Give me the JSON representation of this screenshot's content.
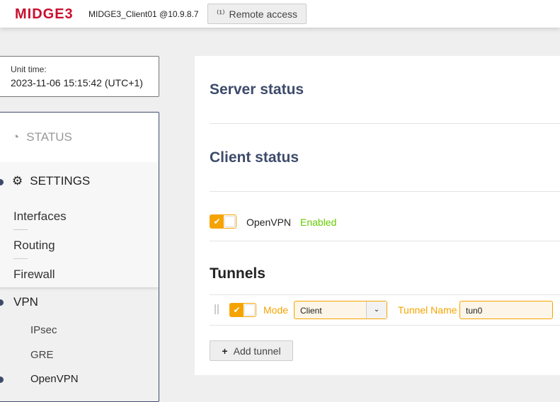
{
  "header": {
    "logo": "MIDGE3",
    "host": "MIDGE3_Client01 @10.9.8.7",
    "remote_access": "Remote access"
  },
  "unit_time": {
    "label": "Unit time:",
    "value": "2023-11-06 15:15:42 (UTC+1)"
  },
  "sidebar": {
    "status": "STATUS",
    "settings": "SETTINGS",
    "settings_items": [
      "Interfaces",
      "Routing",
      "Firewall"
    ],
    "vpn": "VPN",
    "vpn_items": [
      "IPsec",
      "GRE",
      "OpenVPN"
    ]
  },
  "main": {
    "server_status": "Server status",
    "client_status": "Client status",
    "openvpn_label": "OpenVPN",
    "openvpn_state": "Enabled",
    "tunnels_title": "Tunnels",
    "tunnel": {
      "mode_label": "Mode",
      "mode_value": "Client",
      "name_label": "Tunnel Name",
      "name_value": "tun0",
      "enabled": true
    },
    "add_tunnel": "Add tunnel"
  },
  "colors": {
    "accent": "#f5a300",
    "enabled": "#66cc00",
    "heading": "#3d4b6b",
    "brand": "#c8102e"
  }
}
